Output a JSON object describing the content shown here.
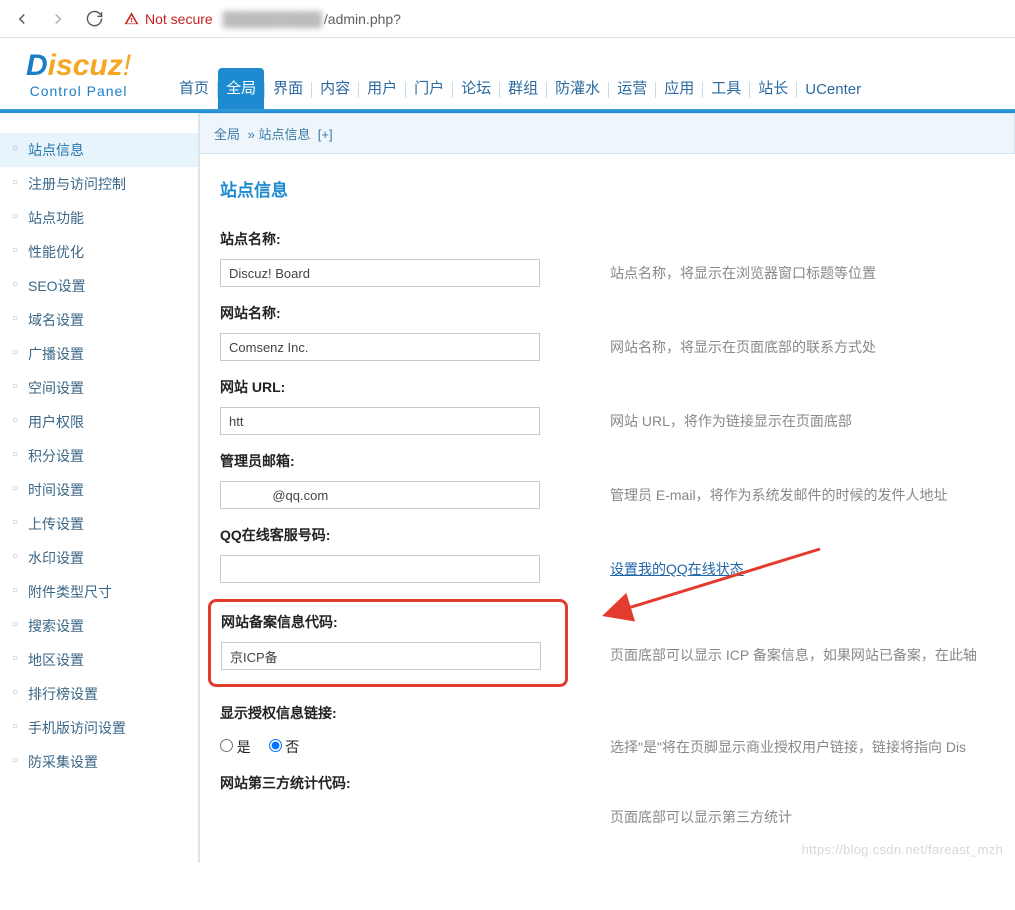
{
  "browser": {
    "not_secure": "Not secure",
    "url_prefix_blur": "██████████",
    "url_suffix": "/admin.php?"
  },
  "logo": {
    "d": "D",
    "rest": "iscuz",
    "bang": "!",
    "subtitle": "Control Panel"
  },
  "tabs": [
    "首页",
    "全局",
    "界面",
    "内容",
    "用户",
    "门户",
    "论坛",
    "群组",
    "防灌水",
    "运营",
    "应用",
    "工具",
    "站长",
    "UCenter"
  ],
  "tabs_active_index": 1,
  "breadcrumb": {
    "a": "全局",
    "sep": "»",
    "b": "站点信息",
    "plus": "[+]"
  },
  "sidebar": {
    "items": [
      "站点信息",
      "注册与访问控制",
      "站点功能",
      "性能优化",
      "SEO设置",
      "域名设置",
      "广播设置",
      "空间设置",
      "用户权限",
      "积分设置",
      "时间设置",
      "上传设置",
      "水印设置",
      "附件类型尺寸",
      "搜索设置",
      "地区设置",
      "排行榜设置",
      "手机版访问设置",
      "防采集设置"
    ],
    "active_index": 0
  },
  "page_title": "站点信息",
  "fields": {
    "site_name": {
      "label": "站点名称:",
      "value": "Discuz! Board",
      "hint": "站点名称，将显示在浏览器窗口标题等位置"
    },
    "web_name": {
      "label": "网站名称:",
      "value": "Comsenz Inc.",
      "hint": "网站名称，将显示在页面底部的联系方式处"
    },
    "web_url": {
      "label": "网站 URL:",
      "value_prefix": "htt",
      "value_blur": "████████████",
      "hint": "网站 URL，将作为链接显示在页面底部"
    },
    "admin_mail": {
      "label": "管理员邮箱:",
      "value_blur": "████████",
      "value_suffix": "@qq.com",
      "hint": "管理员 E-mail，将作为系统发邮件的时候的发件人地址"
    },
    "qq_service": {
      "label": "QQ在线客服号码:",
      "value": "",
      "link": "设置我的QQ在线状态"
    },
    "icp": {
      "label": "网站备案信息代码:",
      "value_prefix": "京ICP备",
      "value_blur": "██████",
      "hint": "页面底部可以显示 ICP 备案信息，如果网站已备案，在此轴"
    },
    "license": {
      "label": "显示授权信息链接:",
      "yes": "是",
      "no": "否",
      "hint": "选择\"是\"将在页脚显示商业授权用户链接，链接将指向 Dis"
    },
    "third_stat": {
      "label": "网站第三方统计代码:",
      "hint": "页面底部可以显示第三方统计"
    }
  },
  "watermark": "https://blog.csdn.net/fareast_mzh"
}
